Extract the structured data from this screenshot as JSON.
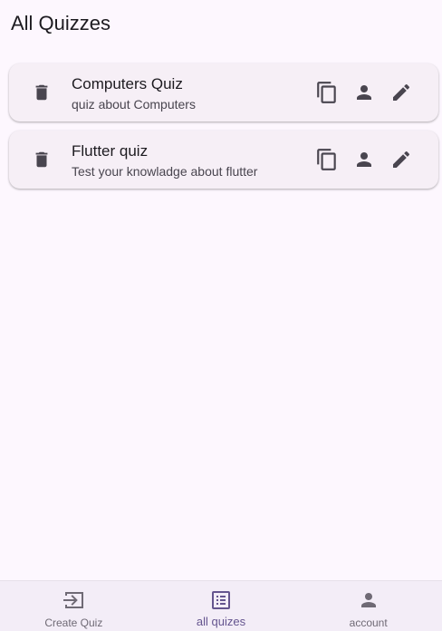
{
  "page": {
    "title": "All Quizzes"
  },
  "quizzes": [
    {
      "title": "Computers Quiz",
      "subtitle": "quiz about Computers"
    },
    {
      "title": "Flutter quiz",
      "subtitle": "Test your knowladge about flutter"
    }
  ],
  "icons": {
    "delete": "delete-icon",
    "copy": "copy-icon",
    "person": "person-icon",
    "edit": "edit-icon"
  },
  "bottom_nav": {
    "items": [
      {
        "label": "Create Quiz",
        "icon": "create-quiz-icon",
        "active": false
      },
      {
        "label": "all quizes",
        "icon": "list-icon",
        "active": true
      },
      {
        "label": "account",
        "icon": "account-icon",
        "active": false
      }
    ]
  },
  "colors": {
    "background": "#fdf7fe",
    "card": "#f6eff6",
    "icon": "#49454f",
    "active": "#65558f",
    "nav_background": "#f3edf7"
  }
}
